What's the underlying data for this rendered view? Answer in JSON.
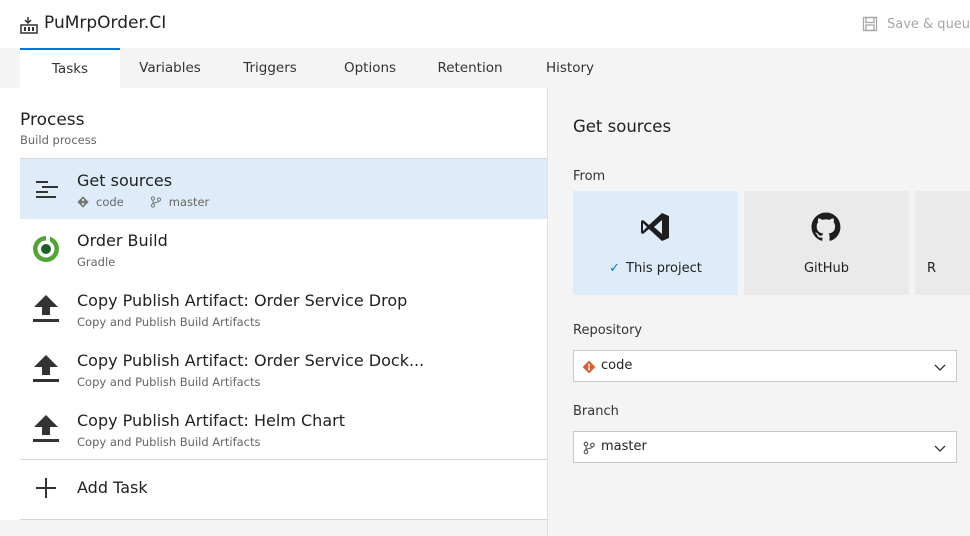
{
  "header": {
    "title": "PuMrpOrder.CI",
    "save_label": "Save & queue"
  },
  "tabs": [
    {
      "label": "Tasks",
      "active": true
    },
    {
      "label": "Variables"
    },
    {
      "label": "Triggers"
    },
    {
      "label": "Options"
    },
    {
      "label": "Retention"
    },
    {
      "label": "History"
    }
  ],
  "process": {
    "title": "Process",
    "subtitle": "Build process"
  },
  "tasks": [
    {
      "name": "Get sources",
      "repo": "code",
      "branch": "master",
      "icon": "get-sources-icon",
      "selected": true
    },
    {
      "name": "Order Build",
      "subtitle": "Gradle",
      "icon": "gradle-icon"
    },
    {
      "name": "Copy Publish Artifact: Order Service Drop",
      "subtitle": "Copy and Publish Build Artifacts",
      "icon": "upload-icon"
    },
    {
      "name": "Copy Publish Artifact: Order Service Dock...",
      "subtitle": "Copy and Publish Build Artifacts",
      "icon": "upload-icon"
    },
    {
      "name": "Copy Publish Artifact: Helm Chart",
      "subtitle": "Copy and Publish Build Artifacts",
      "icon": "upload-icon"
    }
  ],
  "add_task_label": "Add Task",
  "detail": {
    "title": "Get sources",
    "from_label": "From",
    "sources": [
      {
        "label": "This project",
        "icon": "visual-studio-icon",
        "selected": true
      },
      {
        "label": "GitHub",
        "icon": "github-icon"
      },
      {
        "label": "R",
        "icon": ""
      }
    ],
    "repository_label": "Repository",
    "repository_value": "code",
    "branch_label": "Branch",
    "branch_value": "master"
  },
  "colors": {
    "accent": "#0078d4",
    "selected_bg": "#deecf9",
    "git_orange": "#e05a2b",
    "gradle_green": "#52a534"
  }
}
